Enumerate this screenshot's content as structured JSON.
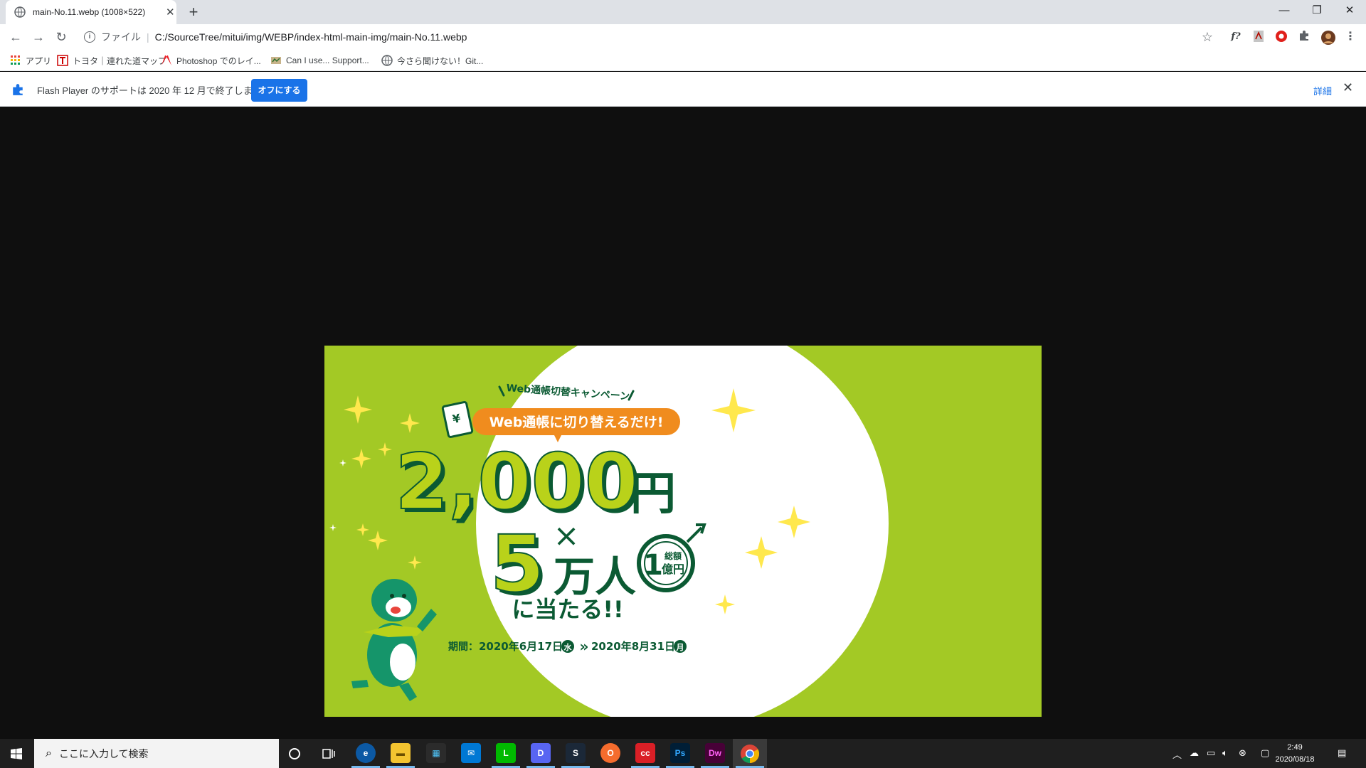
{
  "browser": {
    "tab_title": "main-No.11.webp (1008×522)",
    "new_tab": "+",
    "close_tab": "✕",
    "window_controls": {
      "minimize": "—",
      "restore": "❐",
      "close": "✕"
    },
    "address": {
      "scheme_label": "ファイル",
      "url": "C:/SourceTree/mitui/img/WEBP/index-html-main-img/main-No.11.webp"
    },
    "extensions": [
      "f?",
      "pdf",
      "record",
      "puzzle",
      "avatar",
      "menu"
    ]
  },
  "bookmarks": [
    {
      "label": "アプリ",
      "icon": "apps-grid-icon",
      "color": "#e8453c"
    },
    {
      "label": "トヨタ｜連れた道マップ",
      "icon": "t-icon",
      "color": "#cc0000"
    },
    {
      "label": "Photoshop でのレイ...",
      "icon": "adobe-icon",
      "color": "#ed1c24"
    },
    {
      "label": "Can I use... Support...",
      "icon": "caniuse-icon",
      "color": "#8a6f3b"
    },
    {
      "label": "今さら聞けない！Git...",
      "icon": "globe-icon",
      "color": "#5f6368"
    }
  ],
  "infobar": {
    "message": "Flash Player のサポートは 2020 年 12 月で終了します。",
    "button": "オフにする",
    "details": "詳細",
    "close": "✕"
  },
  "banner": {
    "campaign": "Web通帳切替キャンペーン",
    "headline": "Web通帳に切り替えるだけ!",
    "amount": "2,000",
    "yen": "円",
    "times": "×",
    "people_number": "5",
    "people_unit": "万人",
    "badge_top": "総額",
    "badge_num": "1",
    "badge_bottom": "億円",
    "win": "に当たる!!",
    "period_label": "期間：",
    "period_start": "2020年6月17日",
    "period_start_day": "水",
    "period_arrow": "»",
    "period_end": "2020年8月31日",
    "period_end_day": "月",
    "colors": {
      "background": "#a3c925",
      "circle": "#ffffff",
      "dark_green": "#0b5a33",
      "orange": "#f08c1e",
      "lime": "#b9d21a"
    }
  },
  "taskbar": {
    "search_placeholder": "ここに入力して検索",
    "apps": [
      "edge",
      "explorer",
      "store",
      "mail",
      "line",
      "discord",
      "steam",
      "origin",
      "creative-cloud",
      "Ps",
      "Dw",
      "chrome"
    ],
    "clock_time": "2:49",
    "clock_date": "2020/08/18"
  }
}
